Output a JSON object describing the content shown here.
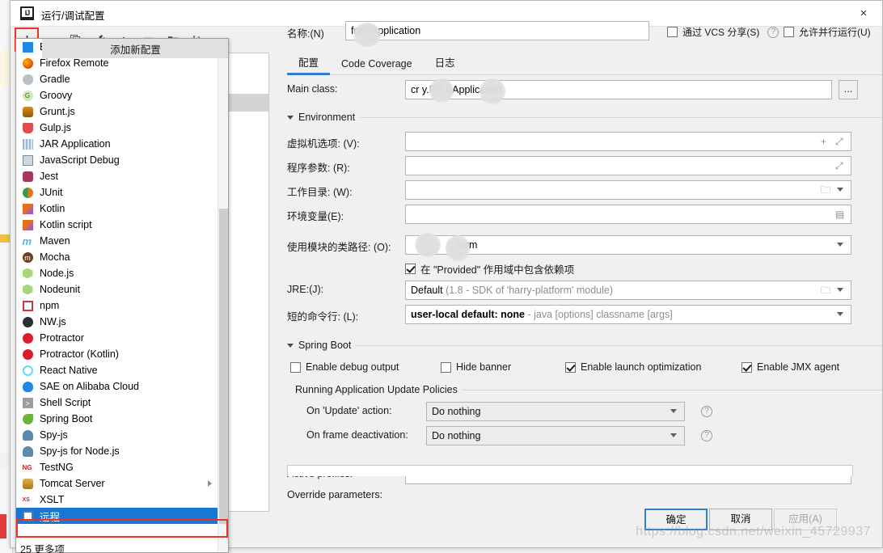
{
  "window": {
    "title": "运行/调试配置",
    "logo_text": "IJ",
    "close_icon": "×"
  },
  "toolbar": {
    "add": "+",
    "remove": "−",
    "copy": "copy-icon",
    "edit_templates": "wrench-icon",
    "move_up": "▲",
    "move_down": "▼",
    "new_folder": "folder-add-icon",
    "sort": "sort-az-icon"
  },
  "popup": {
    "tooltip": "添加新配置",
    "more_label": "25 更多项",
    "items": [
      {
        "label": "EDAS on Alibaba Cloud",
        "icon": "edas-icon",
        "submenu": true,
        "selected": false
      },
      {
        "label": "Firefox Remote",
        "icon": "firefox-icon",
        "submenu": false,
        "selected": false
      },
      {
        "label": "Gradle",
        "icon": "gradle-icon",
        "submenu": false,
        "selected": false
      },
      {
        "label": "Groovy",
        "icon": "groovy-icon",
        "submenu": false,
        "selected": false
      },
      {
        "label": "Grunt.js",
        "icon": "grunt-icon",
        "submenu": false,
        "selected": false
      },
      {
        "label": "Gulp.js",
        "icon": "gulp-icon",
        "submenu": false,
        "selected": false
      },
      {
        "label": "JAR Application",
        "icon": "jar-icon",
        "submenu": false,
        "selected": false
      },
      {
        "label": "JavaScript Debug",
        "icon": "js-debug-icon",
        "submenu": false,
        "selected": false
      },
      {
        "label": "Jest",
        "icon": "jest-icon",
        "submenu": false,
        "selected": false
      },
      {
        "label": "JUnit",
        "icon": "junit-icon",
        "submenu": false,
        "selected": false
      },
      {
        "label": "Kotlin",
        "icon": "kotlin-icon",
        "submenu": false,
        "selected": false
      },
      {
        "label": "Kotlin script",
        "icon": "kotlin-script-icon",
        "submenu": false,
        "selected": false
      },
      {
        "label": "Maven",
        "icon": "maven-icon",
        "submenu": false,
        "selected": false
      },
      {
        "label": "Mocha",
        "icon": "mocha-icon",
        "submenu": false,
        "selected": false
      },
      {
        "label": "Node.js",
        "icon": "nodejs-icon",
        "submenu": false,
        "selected": false
      },
      {
        "label": "Nodeunit",
        "icon": "nodeunit-icon",
        "submenu": false,
        "selected": false
      },
      {
        "label": "npm",
        "icon": "npm-icon",
        "submenu": false,
        "selected": false
      },
      {
        "label": "NW.js",
        "icon": "nwjs-icon",
        "submenu": false,
        "selected": false
      },
      {
        "label": "Protractor",
        "icon": "protractor-icon",
        "submenu": false,
        "selected": false
      },
      {
        "label": "Protractor (Kotlin)",
        "icon": "protractor-icon",
        "submenu": false,
        "selected": false
      },
      {
        "label": "React Native",
        "icon": "react-icon",
        "submenu": false,
        "selected": false
      },
      {
        "label": "SAE on Alibaba Cloud",
        "icon": "sae-icon",
        "submenu": false,
        "selected": false
      },
      {
        "label": "Shell Script",
        "icon": "shell-icon",
        "submenu": false,
        "selected": false
      },
      {
        "label": "Spring Boot",
        "icon": "spring-boot-icon",
        "submenu": false,
        "selected": false
      },
      {
        "label": "Spy-js",
        "icon": "spyjs-icon",
        "submenu": false,
        "selected": false
      },
      {
        "label": "Spy-js for Node.js",
        "icon": "spyjs-node-icon",
        "submenu": false,
        "selected": false
      },
      {
        "label": "TestNG",
        "icon": "testng-icon",
        "submenu": false,
        "selected": false
      },
      {
        "label": "Tomcat Server",
        "icon": "tomcat-icon",
        "submenu": true,
        "selected": false
      },
      {
        "label": "XSLT",
        "icon": "xslt-icon",
        "submenu": false,
        "selected": false
      },
      {
        "label": "远程",
        "icon": "remote-icon",
        "submenu": false,
        "selected": true
      }
    ]
  },
  "header": {
    "name_label": "名称:(N)",
    "name_value": "formApplication",
    "share_vcs_label": "通过 VCS 分享(S)",
    "share_vcs_checked": false,
    "share_help_icon": "?",
    "allow_parallel_label": "允许并行运行(U)",
    "allow_parallel_checked": false
  },
  "tabs": [
    {
      "label": "配置",
      "active": true
    },
    {
      "label": "Code Coverage",
      "active": false
    },
    {
      "label": "日志",
      "active": false
    }
  ],
  "form": {
    "main_class_label": "Main class:",
    "main_class_value": "cr        y.Pla        nApplication",
    "browse_button": "...",
    "environment_section": "Environment",
    "vm_options_label": "虚拟机选项: (V):",
    "vm_options_value": "",
    "program_args_label": "程序参数: (R):",
    "program_args_value": "",
    "working_dir_label": "工作目录: (W):",
    "working_dir_value": "",
    "env_vars_label": "环境变量(E):",
    "env_vars_value": "",
    "module_classpath_label": "使用模块的类路径: (O):",
    "module_classpath_value": ":form",
    "include_provided_label": "在 \"Provided\" 作用域中包含依赖项",
    "include_provided_checked": true,
    "jre_label": "JRE:(J):",
    "jre_value": "Default",
    "jre_hint": "(1.8 - SDK of 'harry-platform' module)",
    "shorten_cmd_label": "短的命令行: (L):",
    "shorten_cmd_value": "user-local default: none",
    "shorten_cmd_hint": "- java [options] classname [args]"
  },
  "spring_boot": {
    "section": "Spring Boot",
    "enable_debug_output": {
      "label": "Enable debug output",
      "checked": false
    },
    "hide_banner": {
      "label": "Hide banner",
      "checked": false
    },
    "enable_launch_optimization": {
      "label": "Enable launch optimization",
      "checked": true
    },
    "enable_jmx_agent": {
      "label": "Enable JMX agent",
      "checked": true
    },
    "update_policies_title": "Running Application Update Policies",
    "on_update_label": "On 'Update' action:",
    "on_update_value": "Do nothing",
    "on_frame_label": "On frame deactivation:",
    "on_frame_value": "Do nothing",
    "help_icon": "?"
  },
  "bottom": {
    "active_profiles_label": "Active profiles:",
    "active_profiles_value": "",
    "override_parameters_label": "Override parameters:"
  },
  "buttons": {
    "ok": "确定",
    "cancel": "取消",
    "apply": "应用(A)"
  },
  "watermark": "https://blog.csdn.net/weixin_45729937",
  "colors": {
    "selection_blue": "#1777d2",
    "highlight_red": "#ee3124",
    "tab_accent": "#2f7fd1",
    "dialog_bg": "#f0f0f0"
  }
}
